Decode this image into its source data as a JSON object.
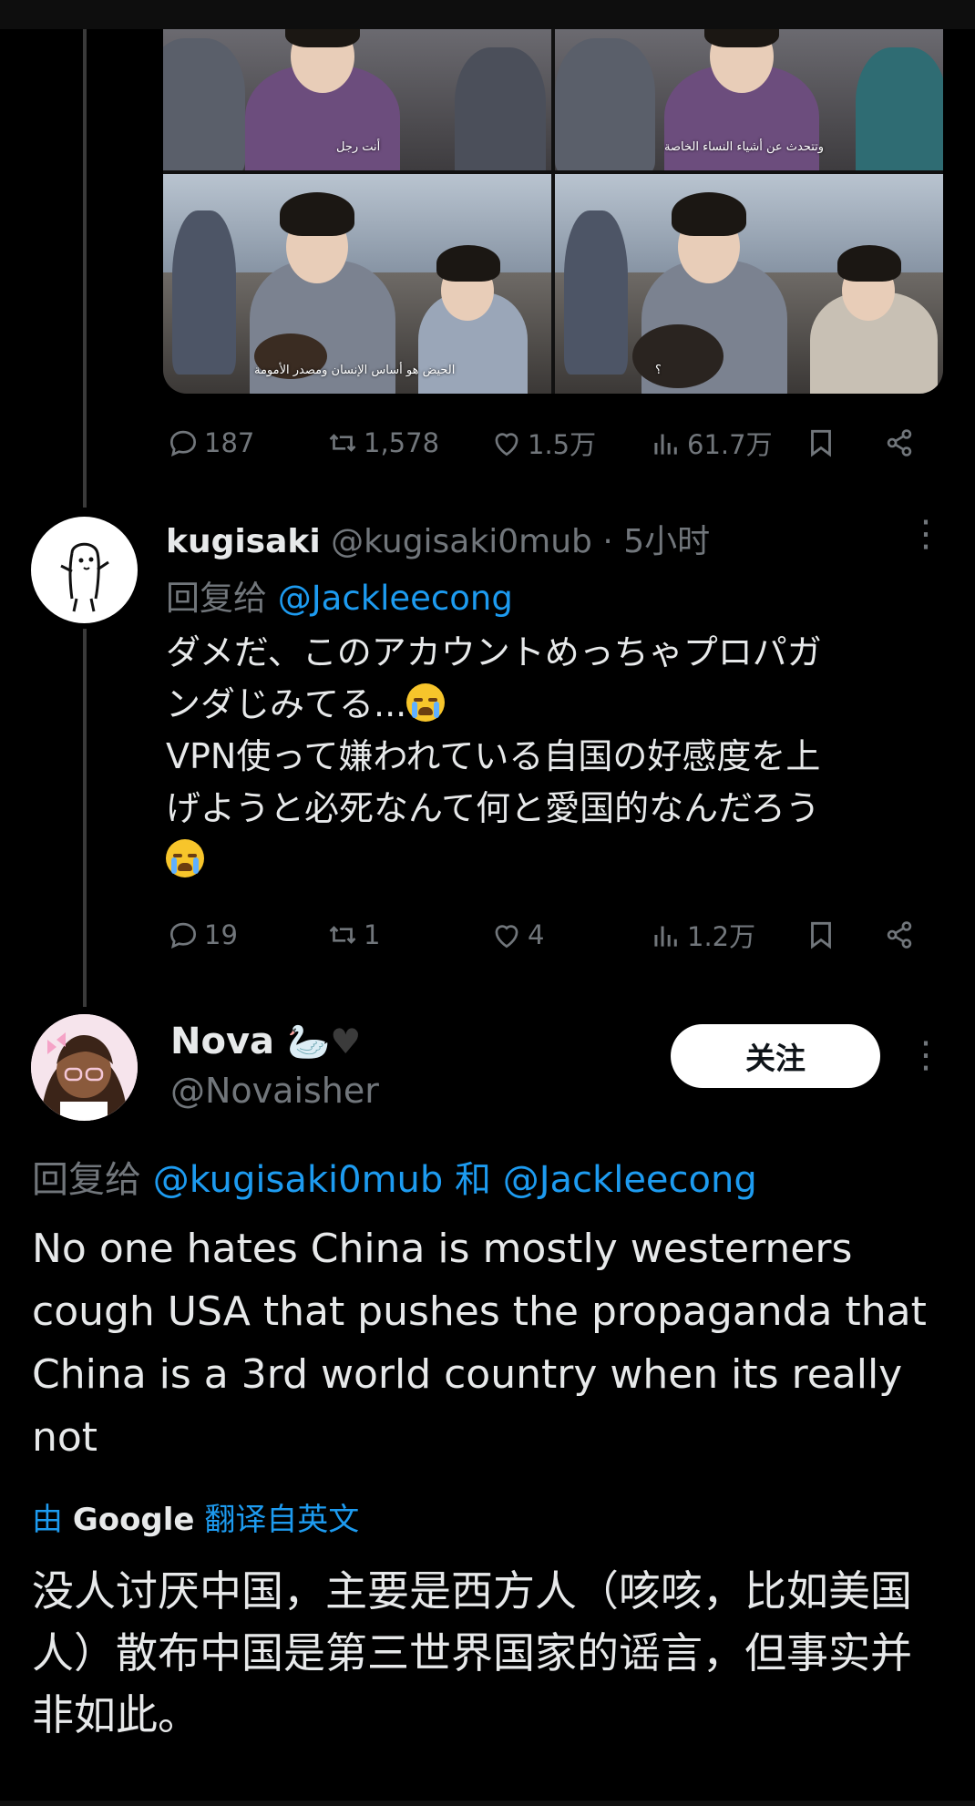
{
  "tweet1_media": {
    "subtitles": [
      "أنت رجل",
      "وتتحدث عن أشياء النساء الخاصة",
      "الحيض هو أساس الإنسان ومصدر الأمومة",
      "؟"
    ]
  },
  "tweet1_stats": {
    "replies": "187",
    "retweets": "1,578",
    "likes": "1.5万",
    "views": "61.7万"
  },
  "reply1": {
    "name": "kugisaki",
    "handle": "@kugisaki0mub",
    "time": "· 5小时",
    "reply_prefix": "回复给",
    "reply_to": "@Jackleecong",
    "text_line1": "ダメだ、このアカウントめっちゃプロパガ",
    "text_line2": "ンダじみてる...",
    "text_line3": "VPN使って嫌われている自国の好感度を上",
    "text_line4": "げようと必死なんて何と愛国的なんだろう",
    "stats": {
      "replies": "19",
      "retweets": "1",
      "likes": "4",
      "views": "1.2万"
    }
  },
  "reply2": {
    "name": "Nova",
    "handle": "@Novaisher",
    "follow_label": "关注",
    "reply_prefix": "回复给",
    "reply_to_1": "@kugisaki0mub",
    "reply_and": "和",
    "reply_to_2": "@Jackleecong",
    "text": "No one hates China is mostly westerners cough USA that pushes the propaganda that China is a 3rd world country when its really not",
    "translate_prefix": "由",
    "translate_brand": "Google",
    "translate_suffix": "翻译自英文",
    "translation": "没人讨厌中国，主要是西方人（咳咳，比如美国人）散布中国是第三世界国家的谣言，但事实并非如此。"
  },
  "colors": {
    "background": "#000000",
    "accent": "#1d9bf0",
    "muted": "#71767b",
    "text": "#e7e9ea"
  },
  "icons": [
    "reply-icon",
    "retweet-icon",
    "like-icon",
    "views-icon",
    "bookmark-icon",
    "share-icon",
    "more-icon",
    "swan-icon",
    "black-heart-icon",
    "crying-face-icon"
  ]
}
